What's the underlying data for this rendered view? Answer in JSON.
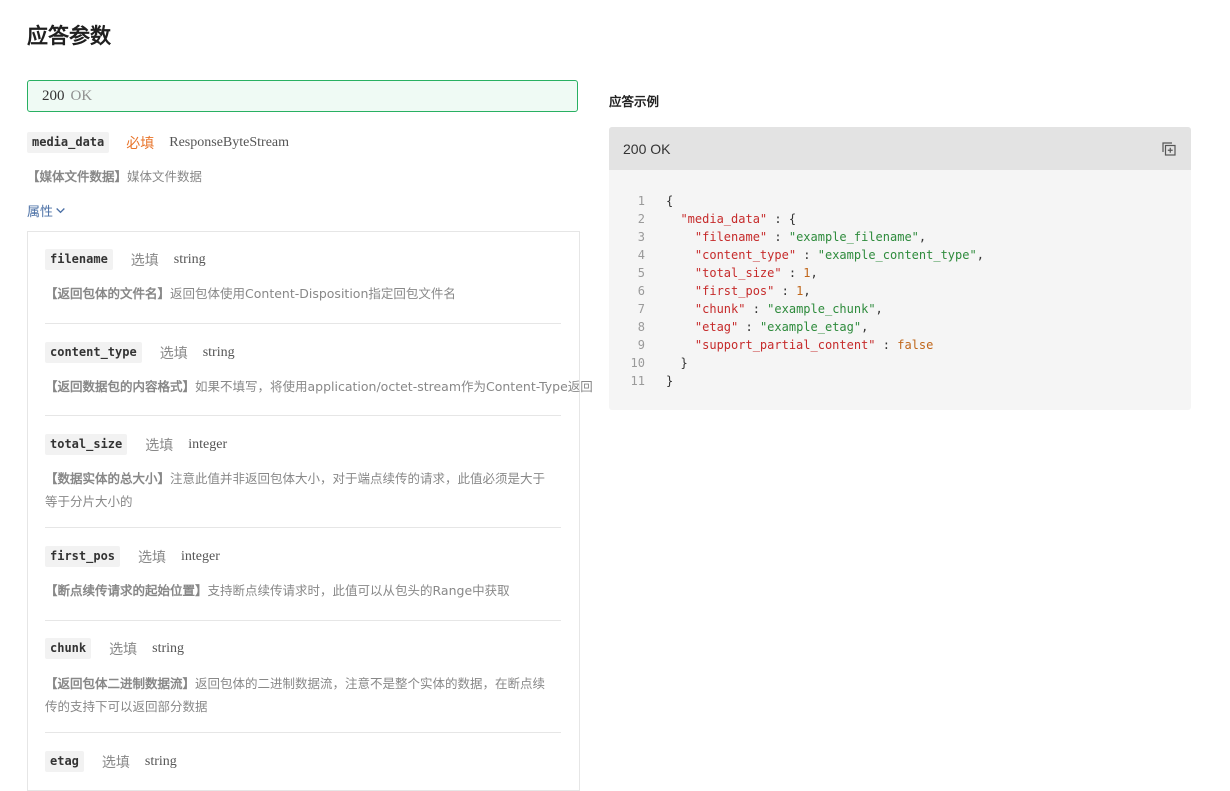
{
  "page_title": "应答参数",
  "status": {
    "code": "200",
    "text": "OK"
  },
  "media_data": {
    "name": "media_data",
    "required_label": "必填",
    "type": "ResponseByteStream",
    "desc_title": "【媒体文件数据】",
    "desc_text": "媒体文件数据"
  },
  "props_label": "属性",
  "fields": [
    {
      "name": "filename",
      "req": "选填",
      "type": "string",
      "desc_title": "【返回包体的文件名】",
      "desc_text": "返回包体使用Content-Disposition指定回包文件名",
      "desc_text2": ""
    },
    {
      "name": "content_type",
      "req": "选填",
      "type": "string",
      "desc_title": "【返回数据包的内容格式】",
      "desc_text": "如果不填写，将使用application/octet-stream作为Content-Type返回",
      "desc_text2": ""
    },
    {
      "name": "total_size",
      "req": "选填",
      "type": "integer",
      "desc_title": "【数据实体的总大小】",
      "desc_text": "注意此值并非返回包体大小，对于端点续传的请求，此值必须是大于",
      "desc_text2": "等于分片大小的"
    },
    {
      "name": "first_pos",
      "req": "选填",
      "type": "integer",
      "desc_title": "【断点续传请求的起始位置】",
      "desc_text": "支持断点续传请求时，此值可以从包头的Range中获取",
      "desc_text2": ""
    },
    {
      "name": "chunk",
      "req": "选填",
      "type": "string",
      "desc_title": "【返回包体二进制数据流】",
      "desc_text": "返回包体的二进制数据流，注意不是整个实体的数据，在断点续",
      "desc_text2": "传的支持下可以返回部分数据"
    },
    {
      "name": "etag",
      "req": "选填",
      "type": "string",
      "desc_title": "",
      "desc_text": "",
      "desc_text2": ""
    }
  ],
  "example": {
    "title": "应答示例",
    "status_label": "200 OK",
    "copy_icon": "copy-icon",
    "lines": [
      {
        "n": "1",
        "t": [
          {
            "c": "p",
            "v": "{"
          }
        ]
      },
      {
        "n": "2",
        "t": [
          {
            "c": "p",
            "v": "  "
          },
          {
            "c": "k",
            "v": "\"media_data\""
          },
          {
            "c": "p",
            "v": " : {"
          }
        ]
      },
      {
        "n": "3",
        "t": [
          {
            "c": "p",
            "v": "    "
          },
          {
            "c": "k",
            "v": "\"filename\""
          },
          {
            "c": "p",
            "v": " : "
          },
          {
            "c": "s",
            "v": "\"example_filename\""
          },
          {
            "c": "p",
            "v": ","
          }
        ]
      },
      {
        "n": "4",
        "t": [
          {
            "c": "p",
            "v": "    "
          },
          {
            "c": "k",
            "v": "\"content_type\""
          },
          {
            "c": "p",
            "v": " : "
          },
          {
            "c": "s",
            "v": "\"example_content_type\""
          },
          {
            "c": "p",
            "v": ","
          }
        ]
      },
      {
        "n": "5",
        "t": [
          {
            "c": "p",
            "v": "    "
          },
          {
            "c": "k",
            "v": "\"total_size\""
          },
          {
            "c": "p",
            "v": " : "
          },
          {
            "c": "n",
            "v": "1"
          },
          {
            "c": "p",
            "v": ","
          }
        ]
      },
      {
        "n": "6",
        "t": [
          {
            "c": "p",
            "v": "    "
          },
          {
            "c": "k",
            "v": "\"first_pos\""
          },
          {
            "c": "p",
            "v": " : "
          },
          {
            "c": "n",
            "v": "1"
          },
          {
            "c": "p",
            "v": ","
          }
        ]
      },
      {
        "n": "7",
        "t": [
          {
            "c": "p",
            "v": "    "
          },
          {
            "c": "k",
            "v": "\"chunk\""
          },
          {
            "c": "p",
            "v": " : "
          },
          {
            "c": "s",
            "v": "\"example_chunk\""
          },
          {
            "c": "p",
            "v": ","
          }
        ]
      },
      {
        "n": "8",
        "t": [
          {
            "c": "p",
            "v": "    "
          },
          {
            "c": "k",
            "v": "\"etag\""
          },
          {
            "c": "p",
            "v": " : "
          },
          {
            "c": "s",
            "v": "\"example_etag\""
          },
          {
            "c": "p",
            "v": ","
          }
        ]
      },
      {
        "n": "9",
        "t": [
          {
            "c": "p",
            "v": "    "
          },
          {
            "c": "k",
            "v": "\"support_partial_content\""
          },
          {
            "c": "p",
            "v": " : "
          },
          {
            "c": "b",
            "v": "false"
          }
        ]
      },
      {
        "n": "10",
        "t": [
          {
            "c": "p",
            "v": "  }"
          }
        ]
      },
      {
        "n": "11",
        "t": [
          {
            "c": "p",
            "v": "}"
          }
        ]
      }
    ]
  },
  "colors": {
    "accent_green": "#28b062",
    "required_orange": "#e8742a",
    "link_blue": "#4a6fa5"
  }
}
